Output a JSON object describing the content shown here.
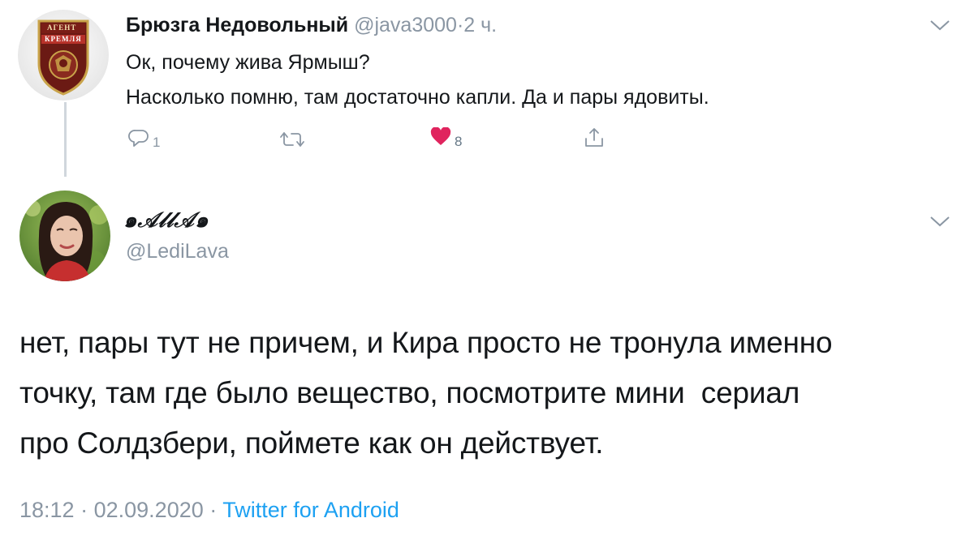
{
  "parent_tweet": {
    "display_name": "Брюзга Недовольный",
    "handle": "@java3000",
    "separator": "·",
    "time_ago": "2 ч.",
    "text_line_1": "Ок, почему жива Ярмыш?",
    "text_line_2": "Насколько помню, там достаточно капли. Да и пары ядовиты.",
    "avatar_badge_top": "АГЕНТ",
    "avatar_badge_bottom": "КРЕМЛЯ",
    "actions": {
      "reply_count": "1",
      "retweet_count": "",
      "like_count": "8",
      "like_color": "#e0245e"
    }
  },
  "reply_tweet": {
    "display_name": "๑𝒜𝓁𝓁𝒜๑",
    "handle": "@LediLava",
    "text_line_1": "нет, пары тут не причем, и Кира просто не тронула именно",
    "text_line_2": "точку, там где было вещество, посмотрите мини  сериал",
    "text_line_3": "про Солдзбери, поймете как он действует.",
    "timestamp_time": "18:12",
    "separator_1": "·",
    "timestamp_date": "02.09.2020",
    "separator_2": "·",
    "source": "Twitter for Android"
  },
  "colors": {
    "accent_blue": "#1da1f2",
    "muted_gray": "#8a96a3",
    "text": "#14171a",
    "like_red": "#e0245e"
  },
  "icons": {
    "reply": "reply-icon",
    "retweet": "retweet-icon",
    "like": "heart-icon",
    "share": "share-icon",
    "menu": "chevron-down-icon"
  }
}
